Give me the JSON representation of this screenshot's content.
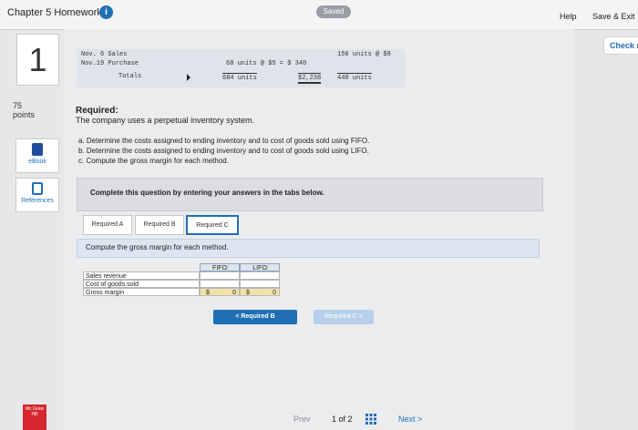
{
  "header": {
    "title": "Chapter 5 Homework",
    "info_icon": "i",
    "status": "Saved",
    "help": "Help",
    "save_exit": "Save & Exit",
    "check_my": "Check m"
  },
  "question": {
    "number": "1",
    "points_value": "75",
    "points_label": "points",
    "ebook": "eBook",
    "references": "References"
  },
  "snippet": {
    "row1_label": "Nov. 6  Sales",
    "row1_right": "150 units @ $8",
    "row2_label": "Nov.19  Purchase",
    "row2_units": "68 units @ $5 = $ 340",
    "row3_label": "Totals",
    "row3_units": "684 units",
    "row3_amount": "$2,238",
    "row3_right": "440 units"
  },
  "required": {
    "title": "Required:",
    "text": "The company uses a perpetual inventory system.",
    "a": "a. Determine the costs assigned to ending inventory and to cost of goods sold using FIFO.",
    "b": "b. Determine the costs assigned to ending inventory and to cost of goods sold using LIFO.",
    "c": "c. Compute the gross margin for each method."
  },
  "instructions": "Complete this question by entering your answers in the tabs below.",
  "tabs": [
    {
      "label": "Required A"
    },
    {
      "label": "Required B"
    },
    {
      "label": "Required C"
    }
  ],
  "tab_prompt": "Compute the gross margin for each method.",
  "table": {
    "headers": [
      "FIFO:",
      "LIFO:"
    ],
    "rows": [
      {
        "label": "Sales revenue"
      },
      {
        "label": "Cost of goods sold"
      },
      {
        "label": "Gross margin",
        "dollar": "$",
        "fifo": "0",
        "lifo": "0"
      }
    ]
  },
  "nav": {
    "prev_btn": "<  Required B",
    "next_btn": "Required C  >",
    "prev": "Prev",
    "page": "1 of 2",
    "next": "Next  >"
  },
  "logo_text": "Mc Graw Hill"
}
